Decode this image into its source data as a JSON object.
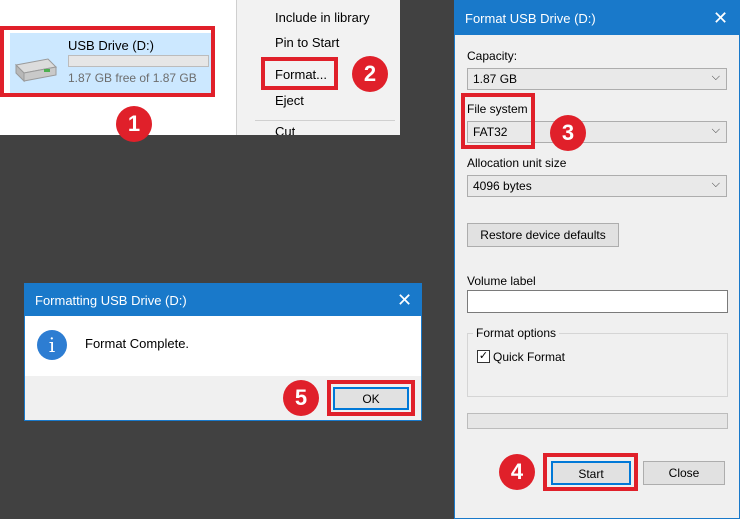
{
  "explorer": {
    "drive_name": "USB Drive (D:)",
    "drive_free": "1.87 GB free of 1.87 GB",
    "drive_used_fraction": 0.0
  },
  "context_menu": {
    "items": [
      "Include in library",
      "Pin to Start",
      "Format...",
      "Eject",
      "Cut"
    ]
  },
  "format_dialog": {
    "title": "Format USB Drive (D:)",
    "capacity_label": "Capacity:",
    "capacity_value": "1.87 GB",
    "filesystem_label": "File system",
    "filesystem_value": "FAT32",
    "alloc_label": "Allocation unit size",
    "alloc_value": "4096 bytes",
    "restore_button": "Restore device defaults",
    "volume_label": "Volume label",
    "volume_value": "",
    "format_options_label": "Format options",
    "quick_format_label": "Quick Format",
    "quick_format_checked": true,
    "progress_fraction": 0.0,
    "start_button": "Start",
    "close_button": "Close"
  },
  "done_dialog": {
    "title": "Formatting USB Drive (D:)",
    "message": "Format Complete.",
    "ok_button": "OK"
  },
  "steps": [
    "1",
    "2",
    "3",
    "4",
    "5"
  ],
  "colors": {
    "accent": "#1979ca",
    "highlight": "#e0202a",
    "selection": "#cce8ff",
    "background": "#414141"
  }
}
